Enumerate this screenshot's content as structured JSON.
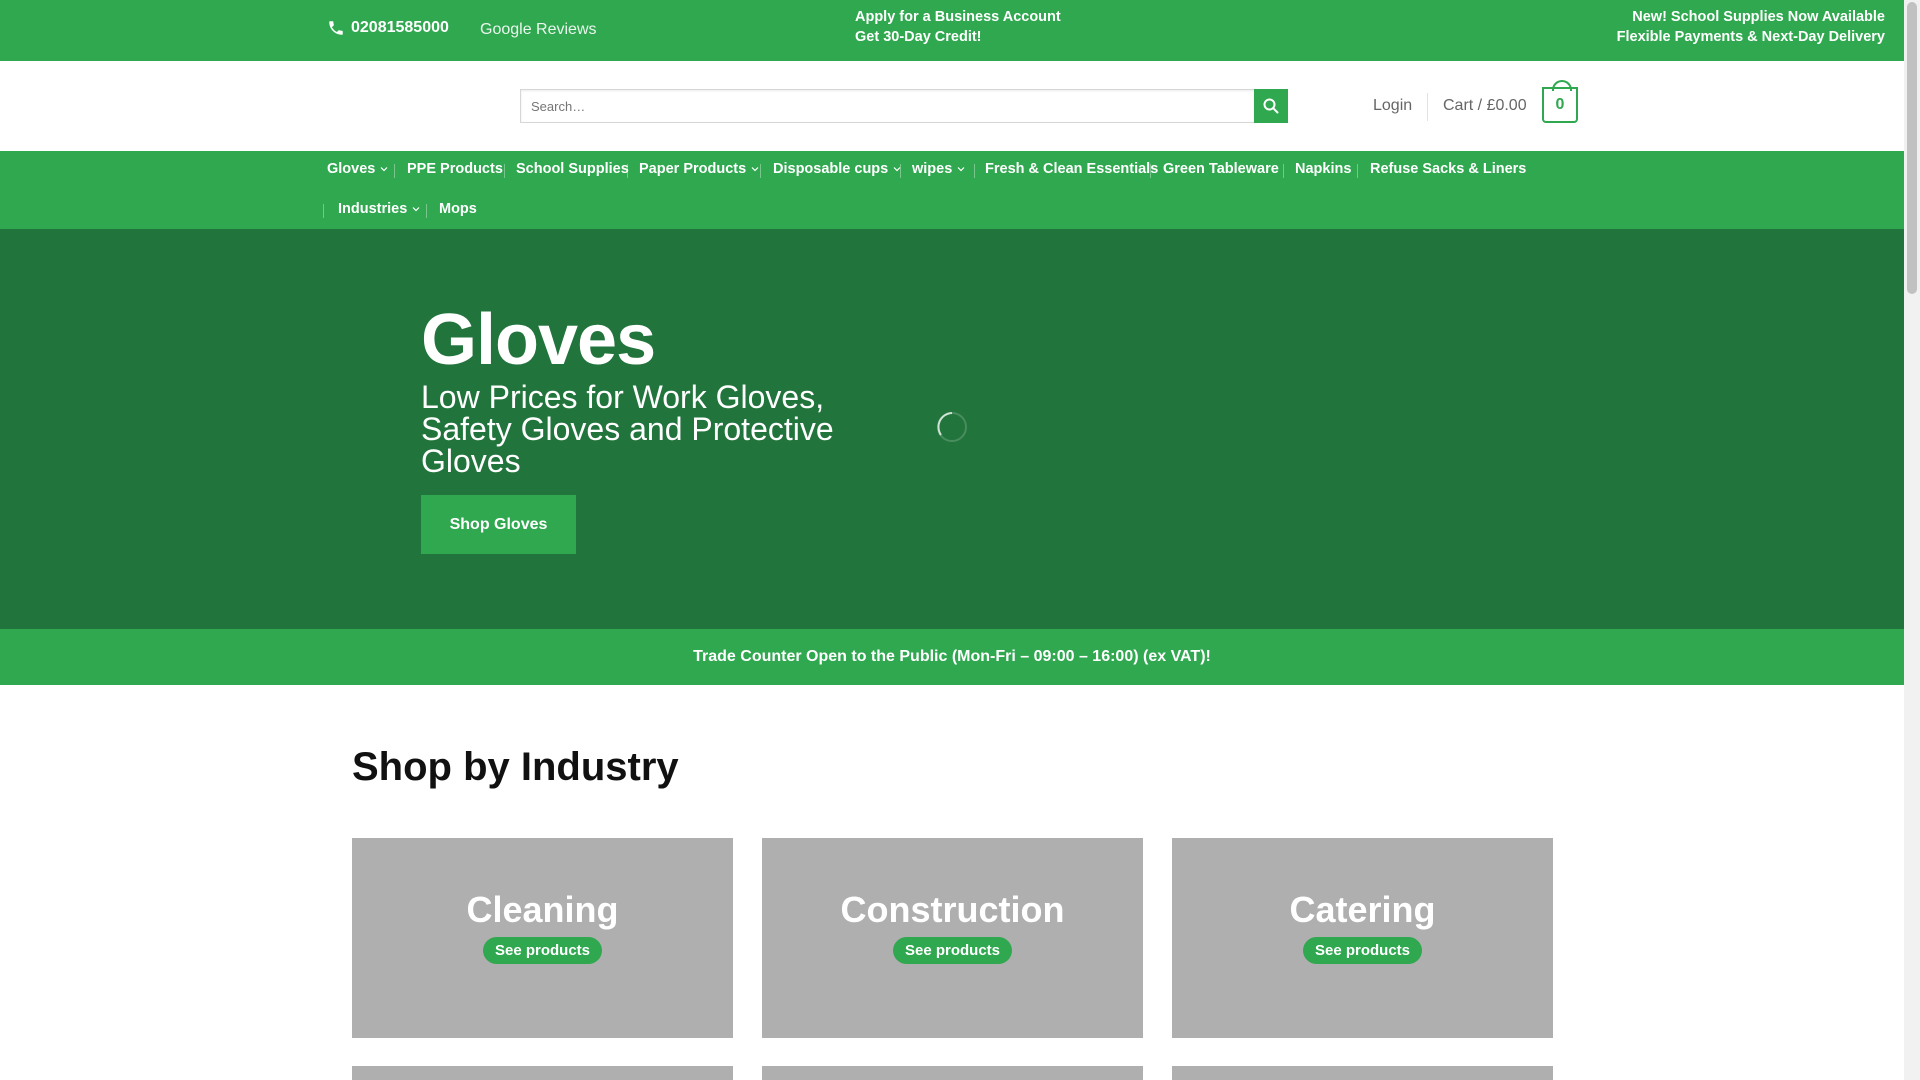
{
  "topbar": {
    "phone": "02081585000",
    "reviews": "Google Reviews",
    "promo_mid_line1": "Apply for a Business Account",
    "promo_mid_line2": "Get 30-Day Credit!",
    "promo_right_line1": "New! School Supplies Now Available",
    "promo_right_line2": "Flexible Payments & Next-Day Delivery"
  },
  "header": {
    "search_placeholder": "Search…",
    "login": "Login",
    "cart_label": "Cart / £0.00",
    "cart_count": "0"
  },
  "nav": {
    "items": [
      {
        "label": "Gloves",
        "dropdown": true
      },
      {
        "label": "PPE Products",
        "dropdown": false
      },
      {
        "label": "School Supplies",
        "dropdown": false
      },
      {
        "label": "Paper Products",
        "dropdown": true
      },
      {
        "label": "Disposable cups",
        "dropdown": true
      },
      {
        "label": "wipes",
        "dropdown": true
      },
      {
        "label": "Fresh & Clean Essentials",
        "dropdown": false
      },
      {
        "label": "Green Tableware",
        "dropdown": false
      },
      {
        "label": "Napkins",
        "dropdown": false
      },
      {
        "label": "Refuse Sacks & Liners",
        "dropdown": false
      },
      {
        "label": "Industries",
        "dropdown": true
      },
      {
        "label": "Mops",
        "dropdown": false
      }
    ]
  },
  "hero": {
    "title": "Gloves",
    "subtitle": "Low Prices for Work Gloves, Safety Gloves and Protective Gloves",
    "button": "Shop Gloves"
  },
  "trade_banner": "Trade Counter Open to the Public (Mon-Fri – 09:00 – 16:00) (ex VAT)!",
  "industry": {
    "title": "Shop by Industry",
    "cards": [
      {
        "title": "Cleaning",
        "button": "See products"
      },
      {
        "title": "Construction",
        "button": "See products"
      },
      {
        "title": "Catering",
        "button": "See products"
      }
    ]
  },
  "colors": {
    "brand_green": "#2fa84f",
    "hero_green": "#21743b",
    "card_grey": "#afafaf"
  }
}
